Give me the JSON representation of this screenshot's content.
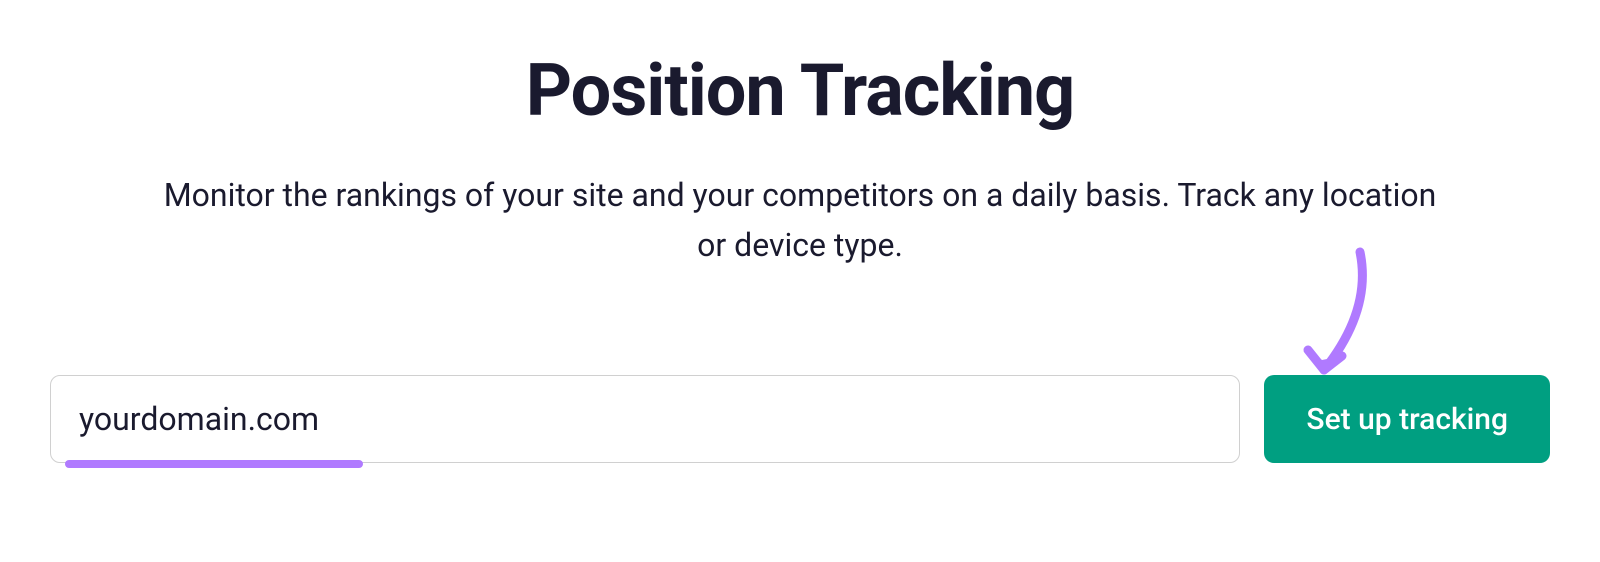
{
  "header": {
    "title": "Position Tracking",
    "subtitle": "Monitor the rankings of your site and your competitors on a daily basis. Track any location or device type."
  },
  "form": {
    "domain_value": "yourdomain.com",
    "button_label": "Set up tracking"
  },
  "colors": {
    "accent_green": "#009f81",
    "annotation_purple": "#b07aff",
    "text_dark": "#1a1a2e"
  }
}
